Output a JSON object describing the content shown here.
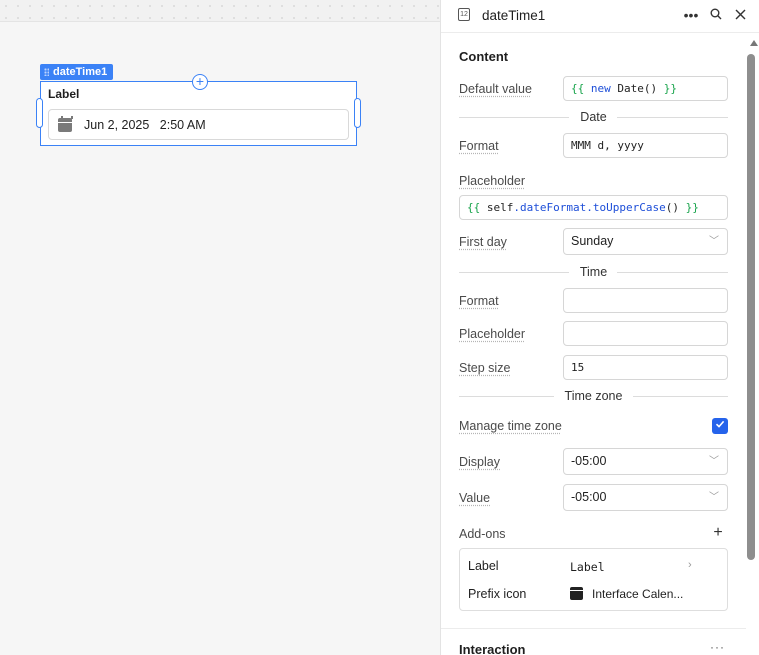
{
  "canvas": {
    "component_tag": "dateTime1",
    "component_label": "Label",
    "date_value": "Jun 2, 2025",
    "time_value": "2:50 AM"
  },
  "panel": {
    "title": "dateTime1",
    "header_icon_text": "12",
    "sections": {
      "content": "Content",
      "addons": "Add-ons",
      "interaction": "Interaction"
    },
    "default_value": {
      "label": "Default value",
      "open": "{{",
      "kw": "new",
      "expr": "Date()",
      "close": "}}"
    },
    "date_divider": "Date",
    "date_format": {
      "label": "Format",
      "value": "MMM d, yyyy"
    },
    "placeholder": {
      "label": "Placeholder",
      "open": "{{",
      "obj": "self",
      "prop": ".dateFormat",
      "method": ".toUpperCase",
      "call": "()",
      "close": "}}"
    },
    "first_day": {
      "label": "First day",
      "value": "Sunday"
    },
    "time_divider": "Time",
    "time_format": {
      "label": "Format",
      "value": ""
    },
    "time_placeholder": {
      "label": "Placeholder",
      "value": ""
    },
    "step_size": {
      "label": "Step size",
      "value": "15"
    },
    "timezone_divider": "Time zone",
    "manage_timezone": {
      "label": "Manage time zone",
      "checked": true
    },
    "display": {
      "label": "Display",
      "value": "-05:00"
    },
    "value": {
      "label": "Value",
      "value": "-05:00"
    },
    "addons": [
      {
        "label": "Label",
        "value": "Label"
      },
      {
        "label": "Prefix icon",
        "value": "Interface Calen..."
      }
    ]
  },
  "icons": {
    "more": "more-horizontal-icon",
    "search": "search-icon",
    "close": "close-icon",
    "calendar": "calendar-icon",
    "chevron": "chevron-down-icon",
    "check": "check-icon",
    "plus": "plus-icon"
  },
  "colors": {
    "accent": "#3b82f6",
    "checkbox": "#2563eb",
    "code_brace": "#16a34a",
    "code_keyword": "#1d4ed8"
  }
}
